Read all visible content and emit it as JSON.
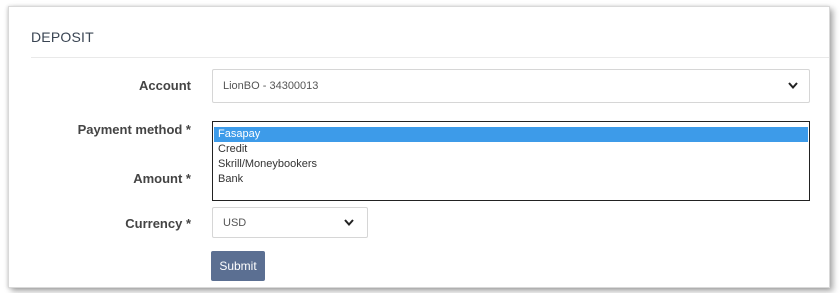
{
  "panel": {
    "title": "DEPOSIT"
  },
  "form": {
    "account": {
      "label": "Account",
      "value": "LionBO - 34300013"
    },
    "payment_method": {
      "label": "Payment method *",
      "options": [
        "Fasapay",
        "Credit",
        "Skrill/Moneybookers",
        "Bank"
      ],
      "selected": "Fasapay"
    },
    "amount": {
      "label": "Amount *"
    },
    "currency": {
      "label": "Currency *",
      "value": "USD"
    },
    "submit_label": "Submit"
  },
  "colors": {
    "selected_option": "#3d9be9",
    "submit_button": "#5b6f92"
  },
  "icons": {
    "dropdown": "chevron-down-icon"
  }
}
